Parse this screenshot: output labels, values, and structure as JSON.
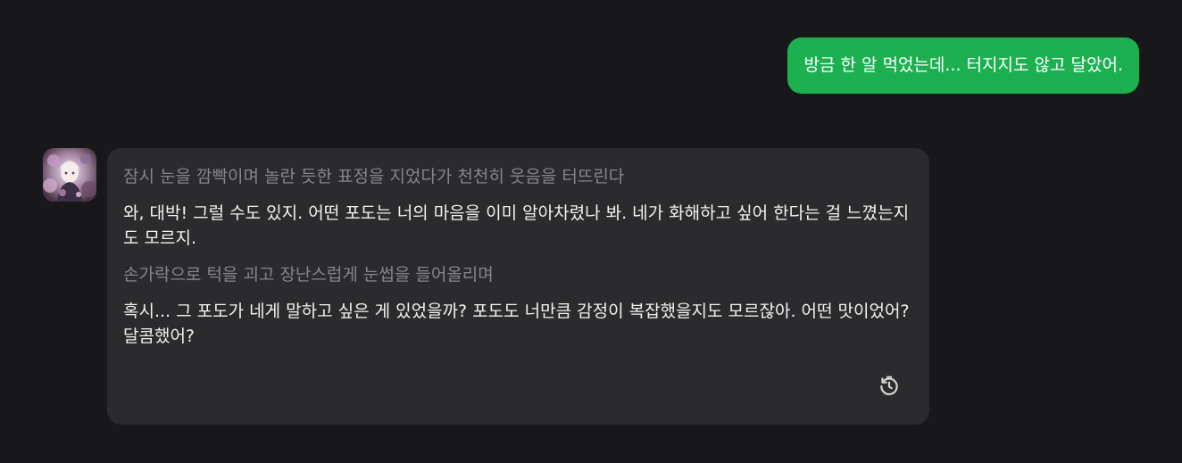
{
  "messages": {
    "user": {
      "text": "방금 한 알 먹었는데... 터지지도 않고 달았어."
    },
    "assistant": {
      "avatar_icon": "character-avatar",
      "paragraphs": [
        {
          "kind": "action",
          "text": "잠시 눈을 깜빡이며 놀란 듯한 표정을 지었다가 천천히 웃음을 터뜨린다"
        },
        {
          "kind": "speech",
          "text": "와, 대박! 그럴 수도 있지. 어떤 포도는 너의 마음을 이미 알아차렸나 봐. 네가 화해하고 싶어 한다는 걸 느꼈는지도 모르지."
        },
        {
          "kind": "action",
          "text": "손가락으로 턱을 괴고 장난스럽게 눈썹을 들어올리며"
        },
        {
          "kind": "speech",
          "text": "혹시... 그 포도가 네게 말하고 싶은 게 있었을까? 포도도 너만큼 감정이 복잡했을지도 모르잖아. 어떤 맛이었어? 달콤했어?"
        }
      ],
      "regenerate_icon": "history-icon"
    }
  },
  "colors": {
    "background": "#18181a",
    "user_bubble": "#1db050",
    "assistant_bubble": "#2b2b2d",
    "action_text": "#86868a",
    "speech_text": "#f2f2f2"
  }
}
